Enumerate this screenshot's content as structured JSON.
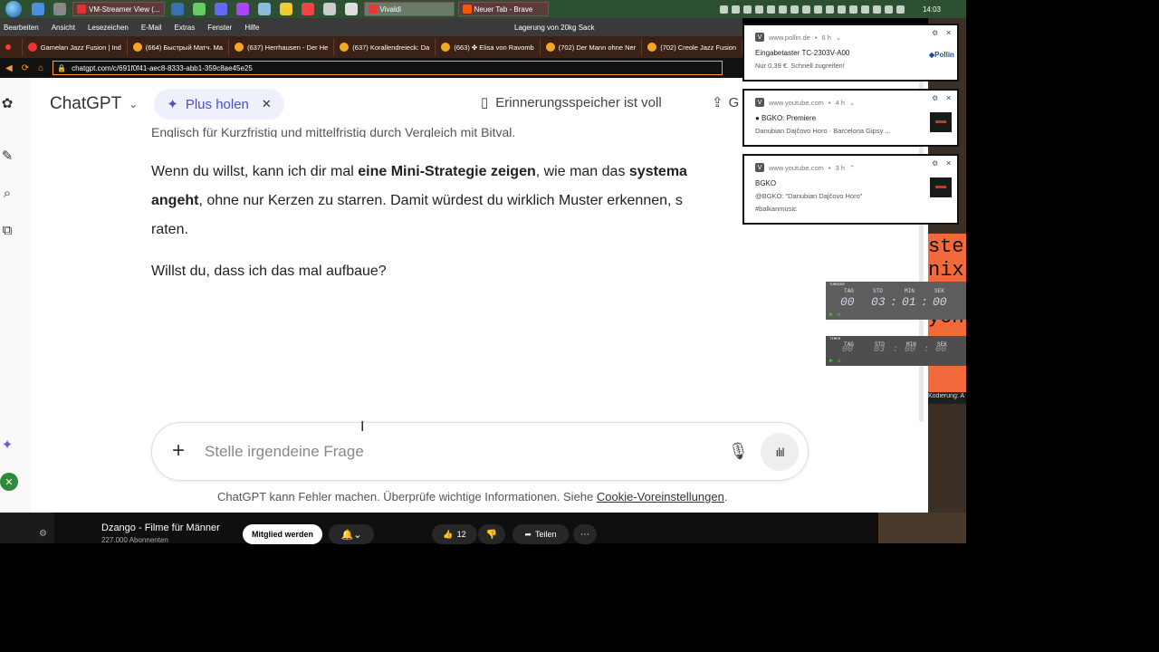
{
  "taskbar": {
    "tasks": [
      {
        "label": "VM-Streamer View (...",
        "color": "#d33"
      },
      {
        "label": "Vivaldi",
        "color": "#e33"
      },
      {
        "label": "Neuer Tab - Brave",
        "color": "#f50"
      }
    ],
    "clock": "14:03"
  },
  "menubar": {
    "items": [
      "Bearbeiten",
      "Ansicht",
      "Lesezeichen",
      "E-Mail",
      "Extras",
      "Fenster",
      "Hilfe"
    ],
    "window_title": "Lagerung von 20kg Sack"
  },
  "tabs": [
    "Gamelan Jazz Fusion | Ind",
    "(664) Быстрый Матч. Ма",
    "(637) Herrhausen - Der He",
    "(637) Korallendreieck: Da",
    "(663) ✤ Elisa von Ravomb",
    "(702) Der Mann ohne Ner",
    "(702) Creole Jazz Fusion"
  ],
  "address": {
    "url": "chatgpt.com/c/691f0f41-aec8-8333-abb1-359c8ae45e25"
  },
  "chat": {
    "model": "ChatGPT",
    "plus_label": "Plus holen",
    "memory_label": "Erinnerungsspeicher ist voll",
    "share_label": "G",
    "cut_line": "Englisch für Kurzfristig und mittelfristig durch Vergleich mit Bitval.",
    "para1_a": "Wenn du willst, kann ich dir mal ",
    "para1_b": "eine Mini-Strategie zeigen",
    "para1_c": ", wie man das ",
    "para1_d": "systema",
    "para1_e": "angeht",
    "para1_f": ", ohne nur Kerzen zu starren. Damit würdest du wirklich Muster erkennen, s",
    "para1_g": "raten.",
    "para2": "Willst du, dass ich das mal aufbaue?",
    "input_placeholder": "Stelle irgendeine Frage",
    "disclaimer": "ChatGPT kann Fehler machen. Überprüfe wichtige Informationen. Siehe ",
    "disclaimer_link": "Cookie-Voreinstellungen",
    "disclaimer_end": "."
  },
  "youtube": {
    "channel": "Dzango - Filme für Männer",
    "subscribers": "227.000 Abonnenten",
    "join": "Mitglied werden",
    "likes": "12",
    "share": "Teilen"
  },
  "notifications": [
    {
      "source": "www.pollin.de",
      "age": "6 h",
      "title": "Eingabetaster TC-2303V-A00",
      "line2": "Nur 0,39 €. Schnell zugreifen!",
      "line3": "",
      "thumb": "pollin"
    },
    {
      "source": "www.youtube.com",
      "age": "4 h",
      "title": "● BGKO: Premiere",
      "line2": "Danubian Dajčovo Horo · Barcelona Gipsy ...",
      "line3": "",
      "thumb": "video"
    },
    {
      "source": "www.youtube.com",
      "age": "3 h",
      "title": "BGKO",
      "line2": "@BGKO: \"Danubian Dajčovo Horo\"",
      "line3": "#balkanmusic",
      "thumb": "video"
    }
  ],
  "timers": [
    {
      "labels": [
        "TAG",
        "STD",
        "MIN",
        "SEK"
      ],
      "values": [
        "00",
        "03",
        "01",
        "00"
      ],
      "caption": "TURNIER"
    },
    {
      "labels": [
        "TAG",
        "STD",
        "MIN",
        "SEK"
      ],
      "values": [
        "00",
        "03",
        "00",
        "00"
      ],
      "caption": "TIMER"
    }
  ],
  "side": {
    "orange_text": "ste\nnix\nur\nyon",
    "encoding": "Kodierung: A"
  },
  "colors": {
    "accent_orange": "#ff9b3b",
    "plus_purple": "#4a4fc4"
  }
}
